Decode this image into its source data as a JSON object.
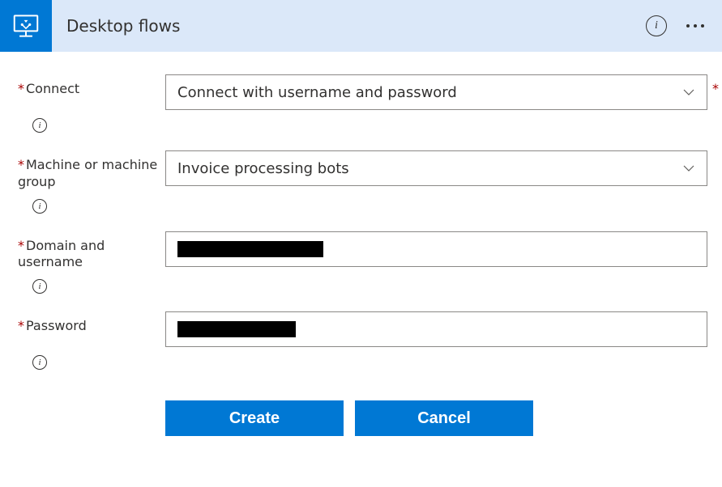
{
  "header": {
    "title": "Desktop flows"
  },
  "fields": {
    "connect": {
      "label": "Connect",
      "value": "Connect with username and password"
    },
    "machine": {
      "label": "Machine or machine group",
      "value": "Invoice processing bots"
    },
    "domain": {
      "label": "Domain and username",
      "value": ""
    },
    "password": {
      "label": "Password",
      "value": ""
    }
  },
  "buttons": {
    "create": "Create",
    "cancel": "Cancel"
  }
}
